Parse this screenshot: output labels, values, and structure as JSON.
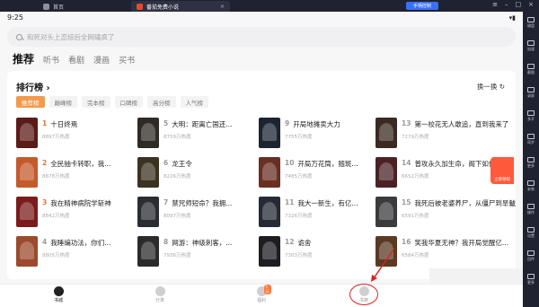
{
  "tabs": {
    "home": "首页",
    "app": "番茄免费小说"
  },
  "toolbar": {
    "control_button": "手柄控制"
  },
  "status": {
    "time": "9:25"
  },
  "search": {
    "placeholder": "和死对头上恋综后全网磕疯了"
  },
  "nav": [
    "推荐",
    "听书",
    "看剧",
    "漫画",
    "买书"
  ],
  "ranking": {
    "title": "排行榜",
    "swap": "换一换",
    "chips": [
      "推荐榜",
      "巅峰榜",
      "完本榜",
      "口碑榜",
      "高分榜",
      "人气榜"
    ],
    "books": [
      {
        "num": "1",
        "title": "十日终焉",
        "hot": "8897万热度",
        "color": "#5b1b17"
      },
      {
        "num": "5",
        "title": "大明：距离亡国还...",
        "hot": "8759万热度",
        "color": "#2f2a24"
      },
      {
        "num": "9",
        "title": "开局地摊卖大力",
        "hot": "7755万热度",
        "color": "#1c2431"
      },
      {
        "num": "13",
        "title": "第一校花无人敢追，直到我来了",
        "hot": "7279万热度",
        "color": "#3a2a22"
      },
      {
        "num": "2",
        "title": "全民抽卡转职，我...",
        "hot": "8878万热度",
        "color": "#c45a2c"
      },
      {
        "num": "6",
        "title": "龙王令",
        "hot": "8226万热度",
        "color": "#3a3322"
      },
      {
        "num": "10",
        "title": "开局万花筒，随斑...",
        "hot": "7485万热度",
        "color": "#6a2f22"
      },
      {
        "num": "14",
        "title": "普攻永久加生命，阁下如何应对",
        "hot": "6652万热度",
        "color": "#4a2226"
      },
      {
        "num": "3",
        "title": "我在精神病院学斩神",
        "hot": "8842万热度",
        "color": "#7a1c1c"
      },
      {
        "num": "7",
        "title": "禁咒师短命？我拥...",
        "hot": "8097万热度",
        "color": "#2a2d33"
      },
      {
        "num": "11",
        "title": "我大一新生，有亿...",
        "hot": "7326万热度",
        "color": "#262a35"
      },
      {
        "num": "15",
        "title": "我死后被老婆养尸，从僵尸到旱魃",
        "hot": "6591万热度",
        "color": "#3b3a3d"
      },
      {
        "num": "4",
        "title": "我睡编功法，你们...",
        "hot": "8805万热度",
        "color": "#9b4a2e"
      },
      {
        "num": "8",
        "title": "网游：神级刺客，...",
        "hot": "7936万热度",
        "color": "#2b2b2b"
      },
      {
        "num": "12",
        "title": "诡舍",
        "hot": "7303万热度",
        "color": "#1d1d22"
      },
      {
        "num": "16",
        "title": "笑我华夏无神？我开局觉醒亿...",
        "hot": "6584万热度",
        "color": "#5a3a24"
      }
    ]
  },
  "gift": {
    "label": "立即领取"
  },
  "bottom_nav": [
    {
      "label": "书城",
      "active": true
    },
    {
      "label": "分类",
      "active": false
    },
    {
      "label": "福利",
      "active": false,
      "badge": "5元"
    },
    {
      "label": "书架",
      "active": false
    }
  ],
  "right_sidebar": [
    "键盘",
    "加速",
    "截图",
    "录屏",
    "多开",
    "同步",
    "更多",
    "安装",
    "操作",
    "设置",
    "回传",
    "更多"
  ]
}
